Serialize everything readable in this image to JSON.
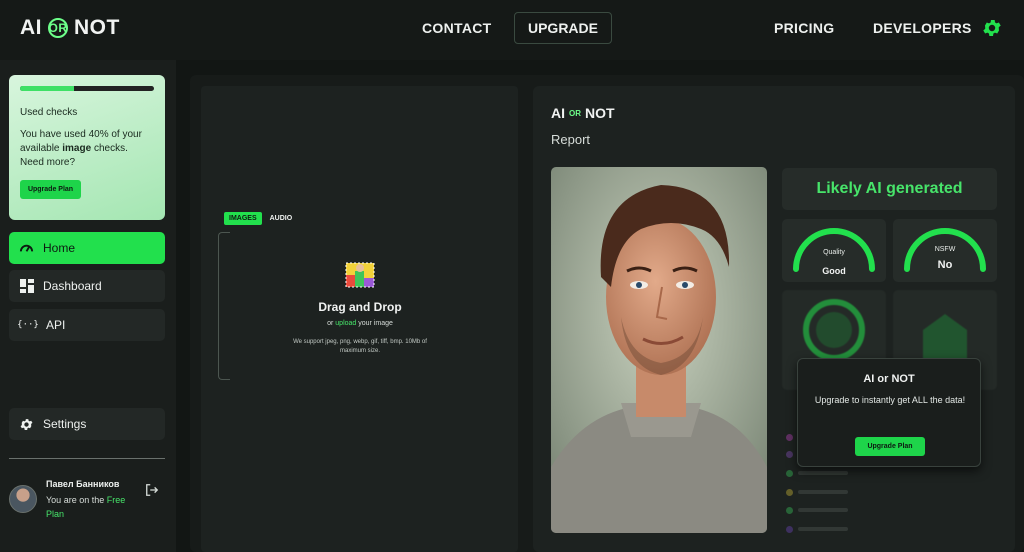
{
  "brand": {
    "name_left": "AI",
    "name_or": "OR",
    "name_right": "NOT",
    "accent": "#22e04d"
  },
  "nav": {
    "contact": "CONTACT",
    "upgrade": "UPGRADE",
    "pricing": "PRICING",
    "developers": "DEVELOPERS",
    "settings_icon": "gear-icon"
  },
  "usage": {
    "progress_fraction": 0.4,
    "title": "Used checks",
    "desc_pre": "You have used 40% of your available ",
    "desc_bold": "image",
    "desc_post": " checks. Need more?",
    "button": "Upgrade Plan"
  },
  "sidebar": {
    "items": [
      {
        "label": "Home",
        "icon": "speedometer-icon"
      },
      {
        "label": "Dashboard",
        "icon": "dashboard-icon"
      },
      {
        "label": "API",
        "icon": "braces-icon"
      },
      {
        "label": "Settings",
        "icon": "gear-icon"
      }
    ]
  },
  "user": {
    "name": "Павел Банников",
    "plan_pre": "You are on the ",
    "plan_link": "Free Plan"
  },
  "upload": {
    "tabs": [
      "IMAGES",
      "AUDIO"
    ],
    "title": "Drag and Drop",
    "sub_pre": "or ",
    "sub_link": "upload",
    "sub_post": " your image",
    "note": "We support jpeg, png, webp, gif, tiff, bmp. 10Mb of maximum size."
  },
  "report": {
    "logo_left": "AI",
    "logo_or": "OR",
    "logo_right": "NOT",
    "title": "Report",
    "verdict": "Likely AI generated",
    "quality": {
      "label": "Quality",
      "value": "Good"
    },
    "nsfw": {
      "label": "NSFW",
      "value": "No"
    },
    "overlay": {
      "title": "AI or NOT",
      "desc": "Upgrade to instantly get ALL the data!",
      "button": "Upgrade Plan"
    }
  }
}
